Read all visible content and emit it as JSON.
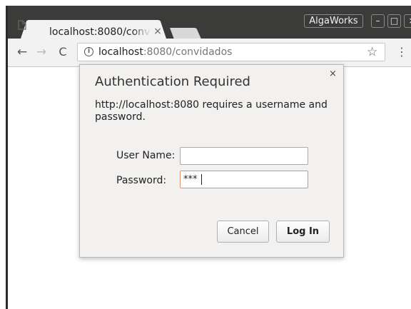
{
  "tab": {
    "title": "localhost:8080/convidados",
    "close_glyph": "×",
    "favicon": "page-icon"
  },
  "window": {
    "profile_label": "AlgaWorks",
    "minimize_glyph": "–",
    "maximize_glyph": "□",
    "close_glyph": "×"
  },
  "toolbar": {
    "back_glyph": "←",
    "forward_glyph": "→",
    "reload_glyph": "C",
    "info_glyph": "i",
    "url_host": "localhost",
    "url_rest": ":8080/convidados",
    "star_glyph": "☆",
    "menu_glyph": "⋮"
  },
  "dialog": {
    "title": "Authentication Required",
    "message": "http://localhost:8080 requires a username and password.",
    "close_glyph": "×",
    "username_label": "User Name:",
    "username_value": "",
    "password_label": "Password:",
    "password_value": "***",
    "cancel_label": "Cancel",
    "login_label": "Log In"
  },
  "colors": {
    "titlebar": "#3b3b3a",
    "toolbar": "#f2f2f2",
    "dialog": "#f2f1f0",
    "focus_border": "#e0906a"
  }
}
